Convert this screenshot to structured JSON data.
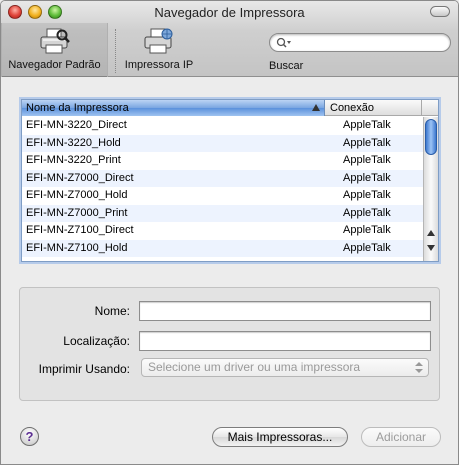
{
  "window": {
    "title": "Navegador de Impressora"
  },
  "toolbar": {
    "default_browser_label": "Navegador Padrão",
    "ip_printer_label": "Impressora IP",
    "search_label": "Buscar",
    "search_value": ""
  },
  "list": {
    "columns": {
      "name": "Nome da Impressora",
      "connection": "Conexão"
    },
    "rows": [
      {
        "name": "EFI-MN-3220_Direct",
        "connection": "AppleTalk"
      },
      {
        "name": "EFI-MN-3220_Hold",
        "connection": "AppleTalk"
      },
      {
        "name": "EFI-MN-3220_Print",
        "connection": "AppleTalk"
      },
      {
        "name": "EFI-MN-Z7000_Direct",
        "connection": "AppleTalk"
      },
      {
        "name": "EFI-MN-Z7000_Hold",
        "connection": "AppleTalk"
      },
      {
        "name": "EFI-MN-Z7000_Print",
        "connection": "AppleTalk"
      },
      {
        "name": "EFI-MN-Z7100_Direct",
        "connection": "AppleTalk"
      },
      {
        "name": "EFI-MN-Z7100_Hold",
        "connection": "AppleTalk"
      }
    ]
  },
  "details": {
    "name_label": "Nome:",
    "name_value": "",
    "location_label": "Localização:",
    "location_value": "",
    "print_using_label": "Imprimir Usando:",
    "print_using_value": "Selecione um driver ou uma impressora"
  },
  "buttons": {
    "help": "?",
    "more_printers": "Mais Impressoras...",
    "add": "Adicionar"
  }
}
